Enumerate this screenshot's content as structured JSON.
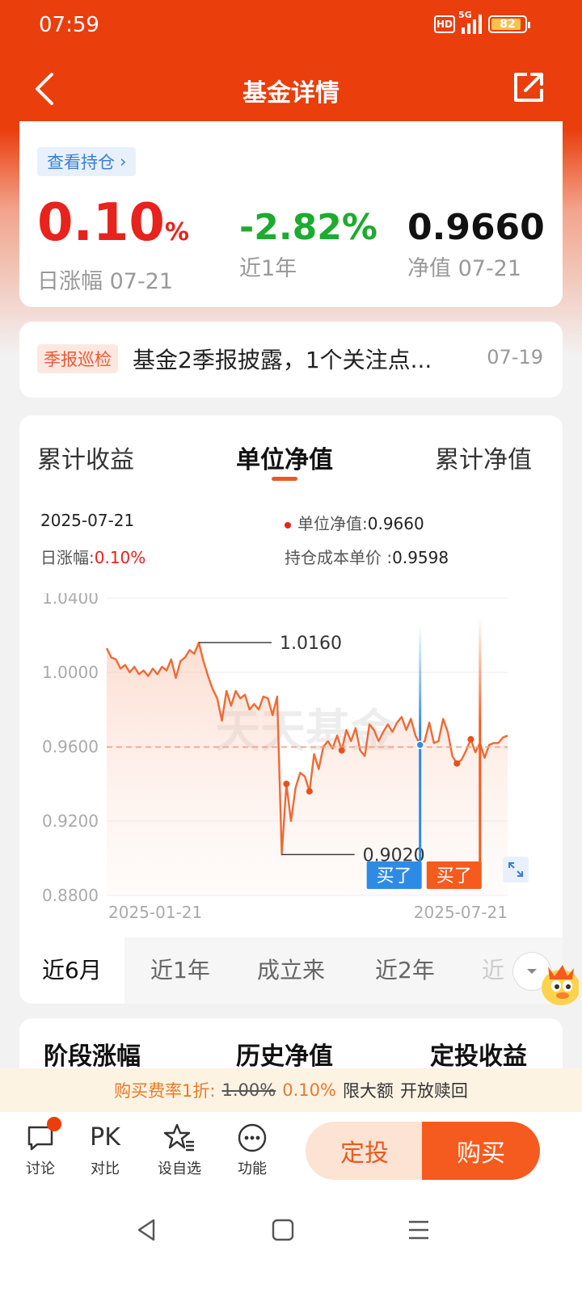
{
  "status_bar": {
    "time": "07:59",
    "network": "5G",
    "hd": "HD",
    "battery": "82"
  },
  "nav": {
    "title": "基金详情"
  },
  "summary": {
    "holdings_link": "查看持仓",
    "daily_change": {
      "value": "0.10",
      "unit": "%",
      "label": "日涨幅 07-21"
    },
    "one_year": {
      "value": "-2.82%",
      "label": "近1年"
    },
    "nav_value": {
      "value": "0.9660",
      "label": "净值 07-21"
    }
  },
  "news": {
    "tag": "季报巡检",
    "text": "基金2季报披露，1个关注点...",
    "date": "07-19"
  },
  "chart_tabs": [
    "累计收益",
    "单位净值",
    "累计净值"
  ],
  "chart_info": {
    "date": "2025-07-21",
    "unit_nav_label": "单位净值:",
    "unit_nav_value": "0.9660",
    "daily_label": "日涨幅:",
    "daily_value": "0.10%",
    "cost_label": "持仓成本单价 :",
    "cost_value": "0.9598"
  },
  "chart_data": {
    "type": "line",
    "x_start": "2025-01-21",
    "x_end": "2025-07-21",
    "ylim": [
      0.88,
      1.04
    ],
    "yticks": [
      "1.0400",
      "1.0000",
      "0.9600",
      "0.9200",
      "0.8800"
    ],
    "xticks": [
      "2025-01-21",
      "2025-07-21"
    ],
    "reference_line": 0.9598,
    "max_label": "1.0160",
    "min_label": "0.9020",
    "buy_labels": [
      "买了",
      "买了"
    ],
    "watermark": "天天基金",
    "series": [
      {
        "values": [
          1.013,
          1.008,
          1.007,
          1.002,
          1.004,
          1.0,
          1.003,
          0.999,
          1.001,
          0.998,
          1.002,
          0.999,
          1.003,
          1.001,
          1.007,
          0.997,
          1.006,
          1.008,
          1.012,
          1.01,
          1.016,
          1.006,
          0.998,
          0.991,
          0.986,
          0.974,
          0.99,
          0.982,
          0.99,
          0.986,
          0.988,
          0.98,
          0.983,
          0.98,
          0.987,
          0.986,
          0.977,
          0.987,
          0.902,
          0.94,
          0.92,
          0.938,
          0.946,
          0.944,
          0.936,
          0.956,
          0.948,
          0.96,
          0.963,
          0.959,
          0.966,
          0.958,
          0.969,
          0.963,
          0.97,
          0.958,
          0.955,
          0.972,
          0.969,
          0.963,
          0.968,
          0.972,
          0.968,
          0.973,
          0.976,
          0.969,
          0.975,
          0.966,
          0.961,
          0.963,
          0.973,
          0.962,
          0.963,
          0.975,
          0.968,
          0.955,
          0.951,
          0.953,
          0.958,
          0.964,
          0.957,
          0.962,
          0.954,
          0.961,
          0.962,
          0.962,
          0.965,
          0.966
        ]
      }
    ]
  },
  "range_tabs": [
    "近6月",
    "近1年",
    "成立来",
    "近2年",
    "近"
  ],
  "stage_tabs": [
    "阶段涨幅",
    "历史净值",
    "定投收益"
  ],
  "promo": {
    "prefix": "购买费率1折:",
    "original": "1.00%",
    "discounted": "0.10%",
    "limit": "限大额",
    "redeem": "开放赎回"
  },
  "bottom_bar": {
    "discuss": "讨论",
    "pk_icon": "PK",
    "compare": "对比",
    "watchlist": "设自选",
    "functions": "功能",
    "sip_button": "定投",
    "buy_button": "购买"
  },
  "colors": {
    "brand": "#ea3e0d",
    "line": "#ef6a35",
    "buy_blue": "#2d8be6",
    "buy_orange": "#f55a1e",
    "up_red": "#e8221c",
    "down_green": "#1eab2f"
  }
}
